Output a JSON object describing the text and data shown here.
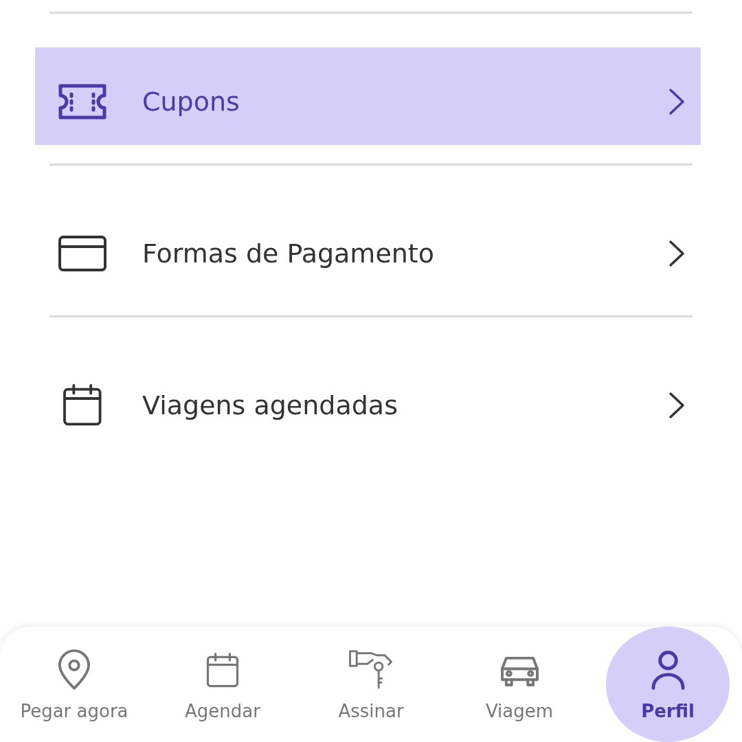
{
  "menu": [
    {
      "label": "Cupons",
      "selected": true
    },
    {
      "label": "Formas de Pagamento",
      "selected": false
    },
    {
      "label": "Viagens agendadas",
      "selected": false
    }
  ],
  "bottom_nav": [
    {
      "label": "Pegar agora",
      "selected": false
    },
    {
      "label": "Agendar",
      "selected": false
    },
    {
      "label": "Assinar",
      "selected": false
    },
    {
      "label": "Viagem",
      "selected": false
    },
    {
      "label": "Perfil",
      "selected": true
    }
  ]
}
